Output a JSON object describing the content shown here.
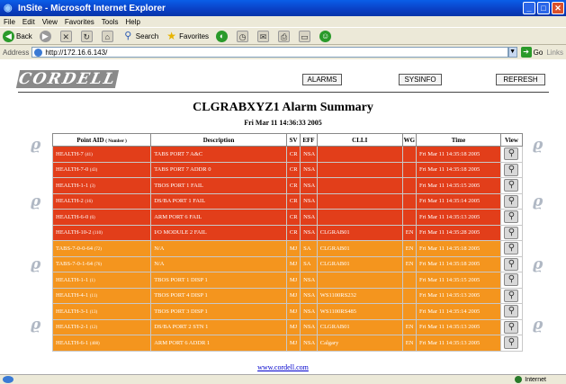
{
  "window": {
    "title": "InSite - Microsoft Internet Explorer",
    "minimize": "_",
    "maximize": "□",
    "close": "✕"
  },
  "menu": [
    "File",
    "Edit",
    "View",
    "Favorites",
    "Tools",
    "Help"
  ],
  "toolbar": {
    "back": "Back",
    "search": "Search",
    "favorites": "Favorites"
  },
  "address": {
    "label": "Address",
    "url": "http://172.16.6.143/",
    "go": "Go",
    "links": "Links"
  },
  "page": {
    "logo": "CORDELL",
    "buttons": {
      "alarms": "ALARMS",
      "sysinfo": "SYSINFO",
      "refresh": "REFRESH"
    },
    "title": "CLGRABXYZ1 Alarm Summary",
    "date": "Fri Mar 11 14:36:33 2005",
    "columns": {
      "point_aid": "Point AID",
      "point_aid_sub": "( Number )",
      "description": "Description",
      "sv": "SV",
      "eff": "EFF",
      "clli": "CLLI",
      "wg": "WG",
      "time": "Time",
      "view": "View"
    },
    "rows": [
      {
        "aid": "HEALTH-7",
        "num": "(41)",
        "desc": "TABS PORT 7 A&C",
        "sv": "CR",
        "eff": "NSA",
        "clli": "",
        "wg": "",
        "time": "Fri Mar 11 14:35:18 2005",
        "severity": "red"
      },
      {
        "aid": "HEALTH-7-0",
        "num": "(43)",
        "desc": "TABS PORT 7 ADDR 0",
        "sv": "CR",
        "eff": "NSA",
        "clli": "",
        "wg": "",
        "time": "Fri Mar 11 14:35:18 2005",
        "severity": "red"
      },
      {
        "aid": "HEALTH-1-1",
        "num": "(3)",
        "desc": "TBOS PORT 1 FAIL",
        "sv": "CR",
        "eff": "NSA",
        "clli": "",
        "wg": "",
        "time": "Fri Mar 11 14:35:15 2005",
        "severity": "red"
      },
      {
        "aid": "HEALTH-2",
        "num": "(16)",
        "desc": "DS/BA PORT 1 FAIL",
        "sv": "CR",
        "eff": "NSA",
        "clli": "",
        "wg": "",
        "time": "Fri Mar 11 14:35:14 2005",
        "severity": "red"
      },
      {
        "aid": "HEALTH-6-0",
        "num": "(6)",
        "desc": "ARM PORT 6 FAIL",
        "sv": "CR",
        "eff": "NSA",
        "clli": "",
        "wg": "",
        "time": "Fri Mar 11 14:35:13 2005",
        "severity": "red"
      },
      {
        "aid": "HEALTH-10-2",
        "num": "(110)",
        "desc": "I/O MODULE 2 FAIL",
        "sv": "CR",
        "eff": "NSA",
        "clli": "CLGRAB01",
        "wg": "EN",
        "time": "Fri Mar 11 14:35:28 2005",
        "severity": "red"
      },
      {
        "aid": "TABS-7-0-0-64",
        "num": "(72)",
        "desc": "N/A",
        "sv": "MJ",
        "eff": "SA",
        "clli": "CLGRAB01",
        "wg": "EN",
        "time": "Fri Mar 11 14:35:18 2005",
        "severity": "orange"
      },
      {
        "aid": "TABS-7-0-1-64",
        "num": "(76)",
        "desc": "N/A",
        "sv": "MJ",
        "eff": "SA",
        "clli": "CLGRAB01",
        "wg": "EN",
        "time": "Fri Mar 11 14:35:18 2005",
        "severity": "orange"
      },
      {
        "aid": "HEALTH-1-1",
        "num": "(1)",
        "desc": "TBOS PORT 1 DISP 1",
        "sv": "MJ",
        "eff": "NSA",
        "clli": "",
        "wg": "",
        "time": "Fri Mar 11 14:35:15 2005",
        "severity": "orange"
      },
      {
        "aid": "HEALTH-4-1",
        "num": "(11)",
        "desc": "TBOS PORT 4 DISP 1",
        "sv": "MJ",
        "eff": "NSA",
        "clli": "WS1100RS232",
        "wg": "",
        "time": "Fri Mar 11 14:35:13 2005",
        "severity": "orange"
      },
      {
        "aid": "HEALTH-3-1",
        "num": "(13)",
        "desc": "TBOS PORT 3 DISP 1",
        "sv": "MJ",
        "eff": "NSA",
        "clli": "WS1100RS485",
        "wg": "",
        "time": "Fri Mar 11 14:35:14 2005",
        "severity": "orange"
      },
      {
        "aid": "HEALTH-2-1",
        "num": "(12)",
        "desc": "DS/BA PORT 2 STN 1",
        "sv": "MJ",
        "eff": "NSA",
        "clli": "CLGRAB01",
        "wg": "EN",
        "time": "Fri Mar 11 14:35:13 2005",
        "severity": "orange"
      },
      {
        "aid": "HEALTH-6-1",
        "num": "(408)",
        "desc": "ARM PORT 6 ADDR 1",
        "sv": "MJ",
        "eff": "NSA",
        "clli": "Calgary",
        "wg": "EN",
        "time": "Fri Mar 11 14:35:13 2005",
        "severity": "orange"
      }
    ],
    "footer_link": "www.cordell.com"
  },
  "status": {
    "zone": "Internet"
  },
  "colors": {
    "critical": "#e23e1a",
    "major": "#f4951e",
    "titlebar": "#0a4fd8"
  }
}
